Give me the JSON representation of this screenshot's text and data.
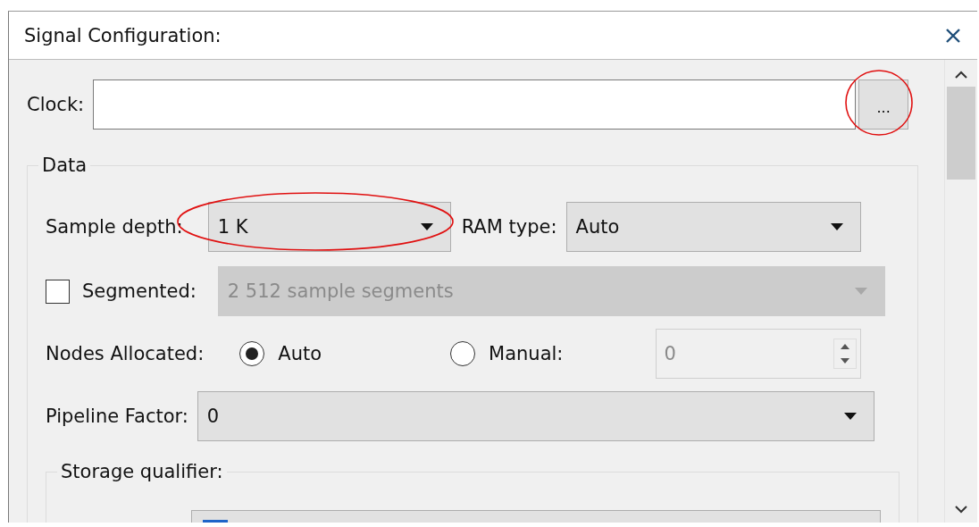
{
  "window": {
    "title": "Signal Configuration:"
  },
  "clock": {
    "label": "Clock:",
    "browse": {
      "label": "...",
      "annotated": true
    }
  },
  "data_group": {
    "title": "Data",
    "sample_depth": {
      "label": "Sample depth:",
      "value": "1 K",
      "annotated": true
    },
    "ram_type": {
      "label": "RAM type:",
      "value": "Auto"
    },
    "segmented": {
      "label": "Segmented:",
      "checked": false,
      "value": "2  512 sample segments",
      "disabled": true
    },
    "nodes_allocated": {
      "label": "Nodes Allocated:",
      "options": [
        {
          "label": "Auto",
          "selected": true
        },
        {
          "label": "Manual:",
          "selected": false
        }
      ],
      "manual_value": "0",
      "manual_disabled": true
    },
    "pipeline_factor": {
      "label": "Pipeline Factor:",
      "value": "0"
    },
    "storage_qualifier": {
      "title": "Storage qualifier:"
    }
  }
}
